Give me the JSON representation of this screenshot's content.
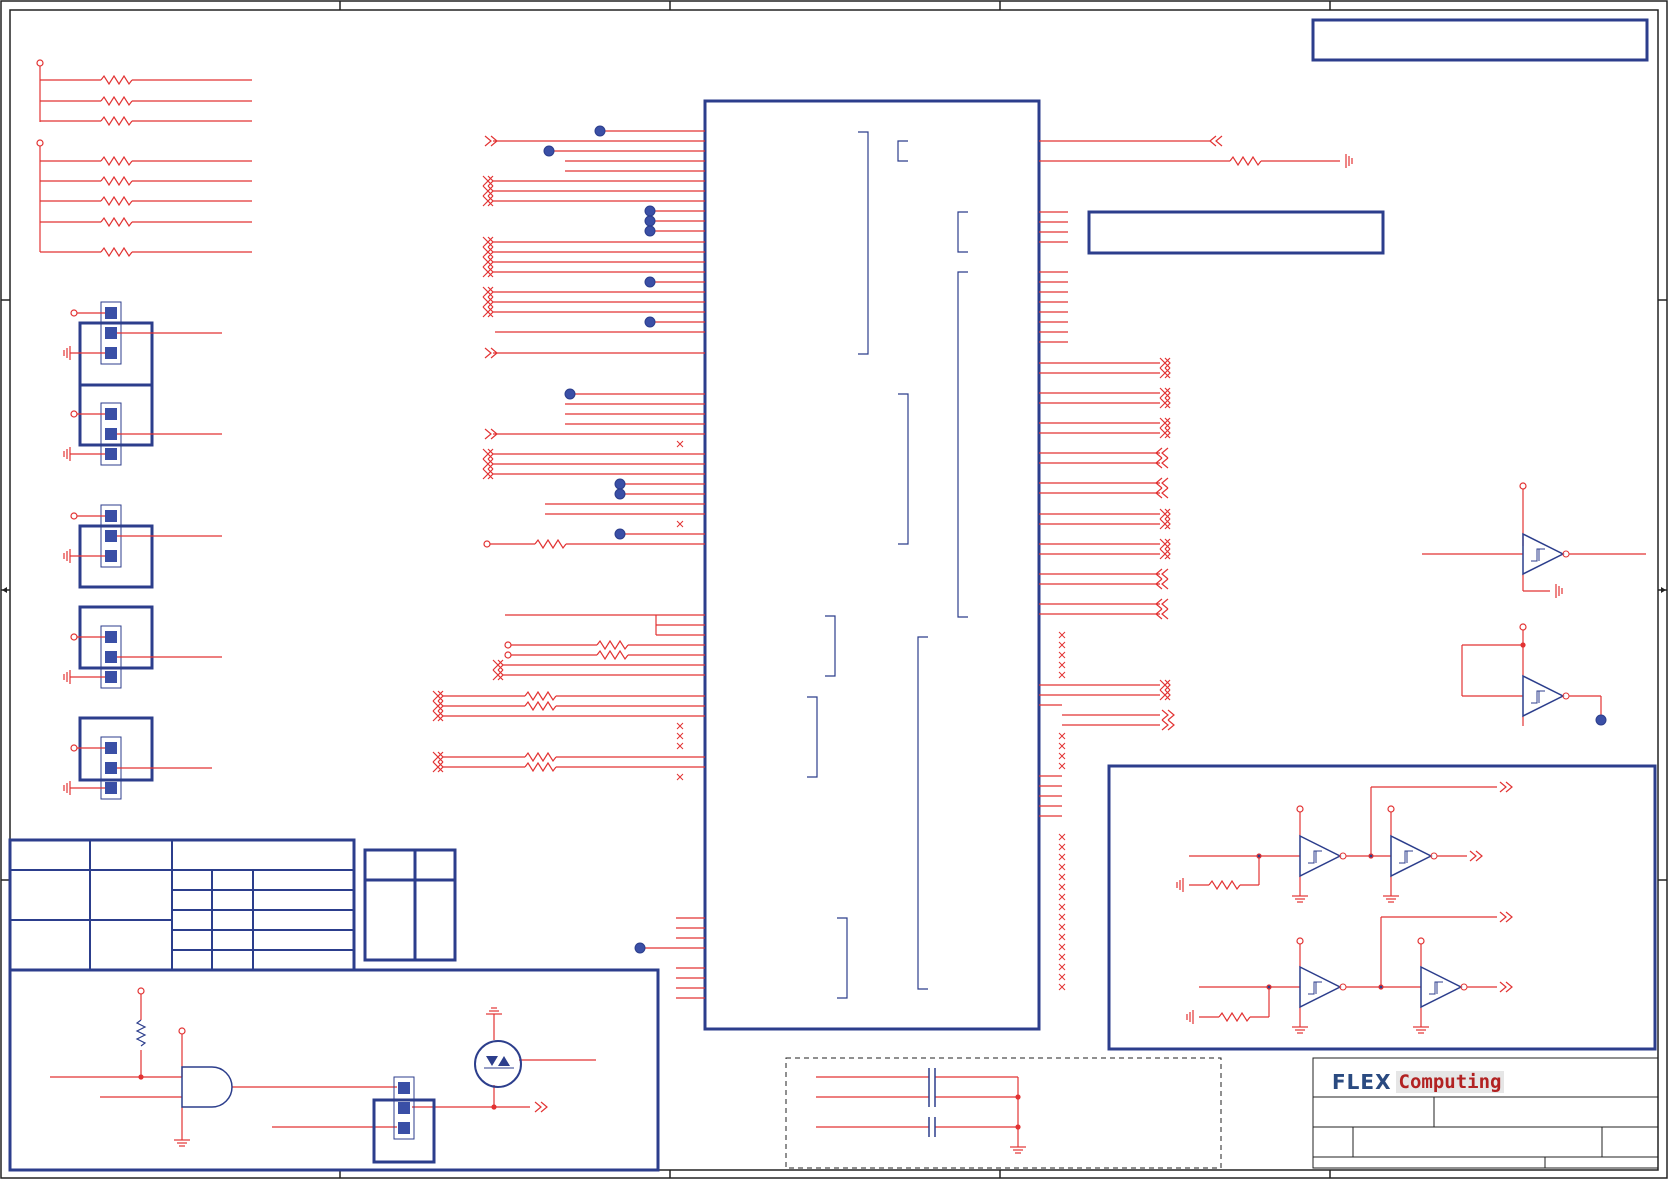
{
  "logo": {
    "brand_flex": "FLEX",
    "brand_computing": "Computing"
  },
  "colors": {
    "wire": "#e23333",
    "outline": "#2c3e8c",
    "frame": "#222222",
    "pad": "#3a4fa6"
  },
  "icons": [
    "ground-icon",
    "resistor-icon",
    "buffer-icon",
    "and-gate-icon",
    "mosfet-icon",
    "capacitor-icon",
    "connector-icon"
  ]
}
